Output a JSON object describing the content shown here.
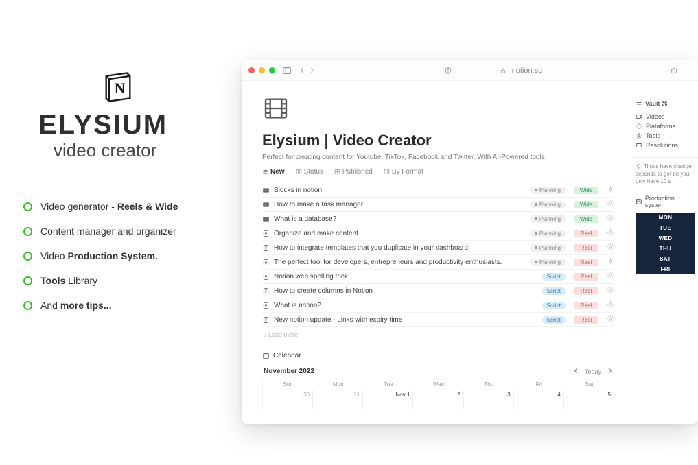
{
  "brand": {
    "title": "ELYSIUM",
    "subtitle": "video creator"
  },
  "features": [
    {
      "pre": "Video generator - ",
      "bold": "Reels & Wide",
      "post": ""
    },
    {
      "pre": "Content manager and organizer",
      "bold": "",
      "post": ""
    },
    {
      "pre": "Video ",
      "bold": "Production System.",
      "post": ""
    },
    {
      "pre": "",
      "bold": "Tools",
      "post": " Library"
    },
    {
      "pre": "And ",
      "bold": "more tips...",
      "post": ""
    }
  ],
  "browser": {
    "address": "notion.so"
  },
  "page": {
    "title": "Elysium | Video Creator",
    "description": "Perfect for creating content for Youtube, TikTok, Facebook and Twitter. With AI-Powered tools."
  },
  "tabs": [
    {
      "label": "New",
      "active": true,
      "icon": "list"
    },
    {
      "label": "Status",
      "active": false,
      "icon": "board"
    },
    {
      "label": "Published",
      "active": false,
      "icon": "table"
    },
    {
      "label": "By Format",
      "active": false,
      "icon": "board"
    }
  ],
  "rows": [
    {
      "icon": "video",
      "title": "Blocks in notion",
      "status": "Planning",
      "format": "Wide",
      "end": "gear"
    },
    {
      "icon": "video",
      "title": "How to make a task manager",
      "status": "Planning",
      "format": "Wide",
      "end": "gear"
    },
    {
      "icon": "video",
      "title": "What is a database?",
      "status": "Planning",
      "format": "Wide",
      "end": "gear"
    },
    {
      "icon": "doc",
      "title": "Organize and make content",
      "status": "Planning",
      "format": "Reel",
      "end": "gear"
    },
    {
      "icon": "doc",
      "title": "How to integrate templates that you duplicate in your dashboard",
      "status": "Planning",
      "format": "Reel",
      "end": "gear"
    },
    {
      "icon": "doc",
      "title": "The perfect tool for developers, entrepreneurs and productivity enthusiasts.",
      "status": "Planning",
      "format": "Reel",
      "end": "gear"
    },
    {
      "icon": "doc",
      "title": "Notion web spelling trick",
      "status": "Script",
      "format": "Reel",
      "end": "gear"
    },
    {
      "icon": "doc",
      "title": "How to create columns in Notion",
      "status": "Script",
      "format": "Reel",
      "end": "gear"
    },
    {
      "icon": "doc",
      "title": "What is notion?",
      "status": "Script",
      "format": "Reel",
      "end": "gear"
    },
    {
      "icon": "doc",
      "title": "New notion update - Links with expiry time",
      "status": "Script",
      "format": "Reel",
      "end": "gear"
    }
  ],
  "load_more": "Load more",
  "calendar": {
    "header": "Calendar",
    "month": "November 2022",
    "today": "Today",
    "dayheads": [
      "Sun",
      "Mon",
      "Tue",
      "Wed",
      "Thu",
      "Fri",
      "Sat"
    ],
    "cells": [
      "30",
      "31",
      "Nov 1",
      "2",
      "3",
      "4",
      "5"
    ]
  },
  "sidebar": {
    "vault_title": "Vault ⌘",
    "vault_items": [
      {
        "icon": "video",
        "label": "Videos"
      },
      {
        "icon": "spark",
        "label": "Plataforms"
      },
      {
        "icon": "gear",
        "label": "Tools"
      },
      {
        "icon": "aspect",
        "label": "Resolutions"
      }
    ],
    "tip": "Times have change seconds to get pe you only have 10 s",
    "prod_title": "Production system",
    "days": [
      "MON",
      "TUE",
      "WED",
      "THU",
      "SAT",
      "FRI"
    ]
  }
}
